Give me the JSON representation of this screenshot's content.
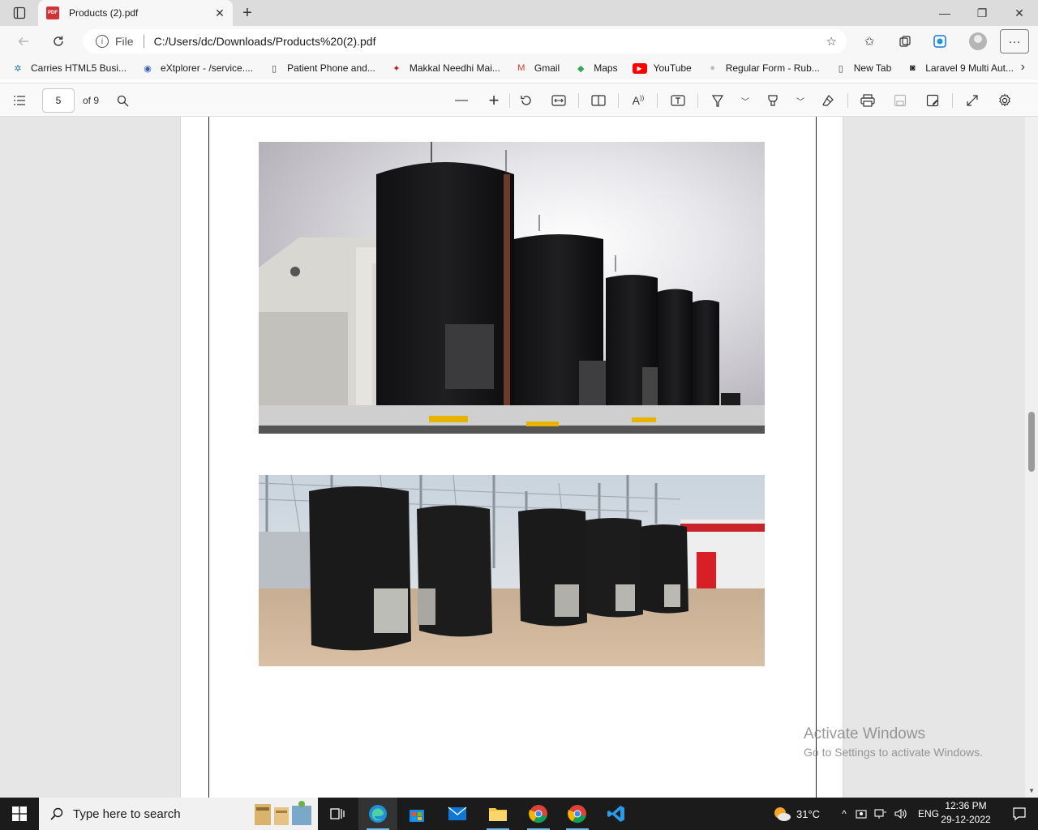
{
  "tab": {
    "title": "Products (2).pdf",
    "close": "✕"
  },
  "window": {
    "minimize": "—",
    "restore": "❐",
    "close": "✕",
    "new_tab": "+"
  },
  "address": {
    "file_label": "File",
    "url": "C:/Users/dc/Downloads/Products%20(2).pdf"
  },
  "bookmarks": [
    {
      "label": "Carries HTML5 Busi...",
      "icon": "carries-icon",
      "color": "#2a7ab8"
    },
    {
      "label": "eXtplorer - /service....",
      "icon": "extplorer-icon",
      "color": "#3a5fa8"
    },
    {
      "label": "Patient Phone and...",
      "icon": "page-icon",
      "color": "#444444"
    },
    {
      "label": "Makkal Needhi Mai...",
      "icon": "makkal-icon",
      "color": "#b41e1e"
    },
    {
      "label": "Gmail",
      "icon": "gmail-icon",
      "color": "#d93025"
    },
    {
      "label": "Maps",
      "icon": "maps-icon",
      "color": "#34a853"
    },
    {
      "label": "YouTube",
      "icon": "youtube-icon",
      "color": "#ff0000"
    },
    {
      "label": "Regular Form - Rub...",
      "icon": "form-icon",
      "color": "#bbbbbb"
    },
    {
      "label": "New Tab",
      "icon": "page-icon",
      "color": "#444444"
    },
    {
      "label": "Laravel 9 Multi Aut...",
      "icon": "laravel-icon",
      "color": "#222222"
    }
  ],
  "pdf_toolbar": {
    "page_current": "5",
    "page_total": "of 9"
  },
  "watermark": {
    "title": "Activate Windows",
    "subtitle": "Go to Settings to activate Windows."
  },
  "taskbar": {
    "search_placeholder": "Type here to search",
    "temperature": "31°C",
    "language": "ENG",
    "time": "12:36 PM",
    "date": "29-12-2022"
  },
  "colors": {
    "accent": "#0078d4",
    "pdf_red": "#d13438",
    "taskbar": "#1b1b1b"
  }
}
